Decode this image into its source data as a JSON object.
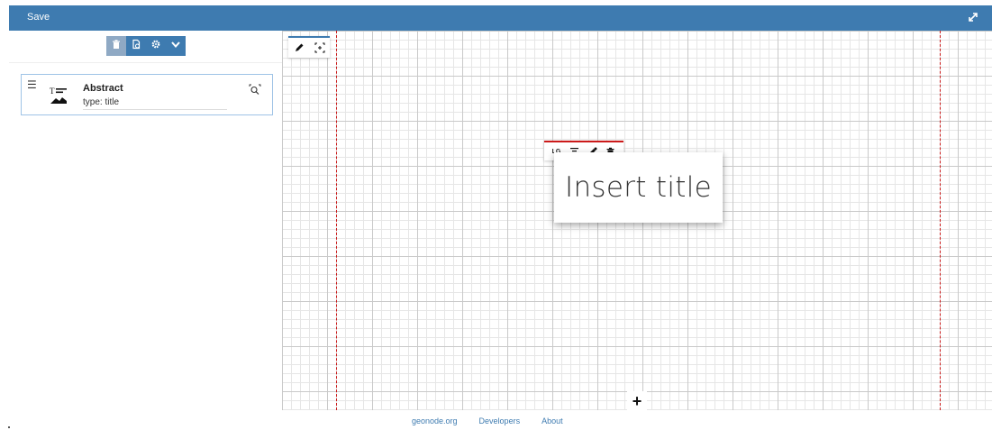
{
  "topbar": {
    "save_label": "Save",
    "expand_icon": "expand-icon"
  },
  "sidebar": {
    "toolbar": {
      "items": [
        "trash-icon",
        "preview-icon",
        "gear-icon",
        "chevron-down-icon"
      ]
    },
    "sections": [
      {
        "title": "Abstract",
        "type_label": "type: title",
        "icon": "title-section-icon"
      }
    ]
  },
  "canvas": {
    "edit_tools": [
      "pencil-icon",
      "fit-icon"
    ],
    "floating_toolbar": {
      "size_label": "LG",
      "icons": [
        "align-icon",
        "eyedropper-icon",
        "trash-icon"
      ]
    },
    "title_placeholder": "Insert title",
    "add_label": "+"
  },
  "footer": {
    "links": [
      "geonode.org",
      "Developers",
      "About"
    ]
  },
  "colors": {
    "accent": "#3e7bb0",
    "guide": "#cc1a1a"
  }
}
